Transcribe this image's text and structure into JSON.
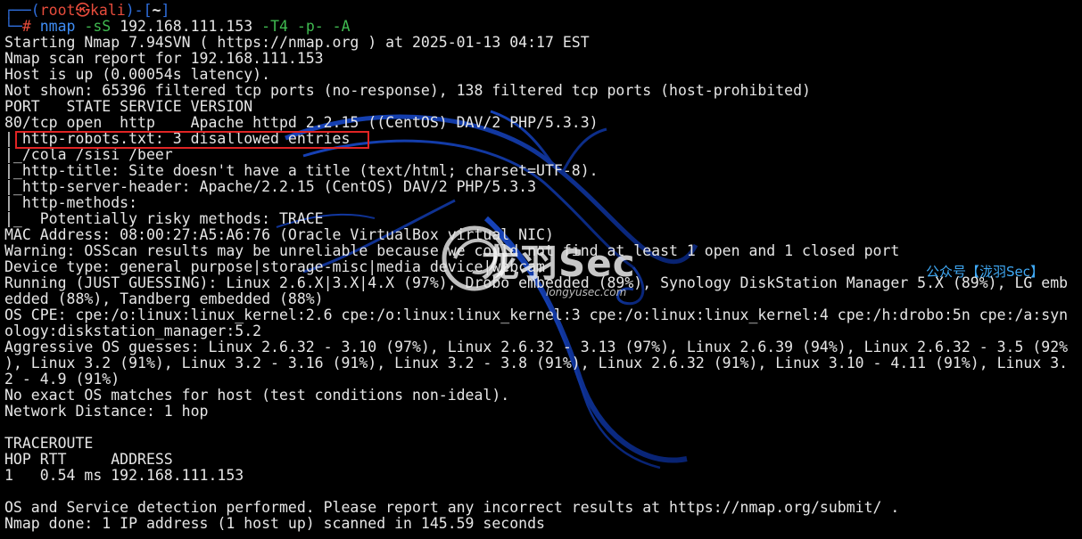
{
  "prompt": {
    "frame_top": "┌──(",
    "user": "root㉿kali",
    "frame_mid": ")-[",
    "dir": "~",
    "frame_end": "]",
    "frame_bottom": "└─",
    "hash": "# ",
    "command": "nmap",
    "flag1": "-sS",
    "target": "192.168.111.153",
    "flag2": "-T4",
    "flag3": "-p-",
    "flag4": "-A"
  },
  "output_lines": [
    "Starting Nmap 7.94SVN ( https://nmap.org ) at 2025-01-13 04:17 EST",
    "Nmap scan report for 192.168.111.153",
    "Host is up (0.00054s latency).",
    "Not shown: 65396 filtered tcp ports (no-response), 138 filtered tcp ports (host-prohibited)",
    "PORT   STATE SERVICE VERSION",
    "80/tcp open  http    Apache httpd 2.2.15 ((CentOS) DAV/2 PHP/5.3.3)",
    "| http-robots.txt: 3 disallowed entries",
    "|_/cola /sisi /beer",
    "|_http-title: Site doesn't have a title (text/html; charset=UTF-8).",
    "|_http-server-header: Apache/2.2.15 (CentOS) DAV/2 PHP/5.3.3",
    "| http-methods:",
    "|_  Potentially risky methods: TRACE",
    "MAC Address: 08:00:27:A5:A6:76 (Oracle VirtualBox virtual NIC)",
    "Warning: OSScan results may be unreliable because we could not find at least 1 open and 1 closed port",
    "Device type: general purpose|storage-misc|media device|webcam",
    "Running (JUST GUESSING): Linux 2.6.X|3.X|4.X (97%), Drobo embedded (89%), Synology DiskStation Manager 5.X (89%), LG emb",
    "edded (88%), Tandberg embedded (88%)",
    "OS CPE: cpe:/o:linux:linux_kernel:2.6 cpe:/o:linux:linux_kernel:3 cpe:/o:linux:linux_kernel:4 cpe:/h:drobo:5n cpe:/a:syn",
    "ology:diskstation_manager:5.2",
    "Aggressive OS guesses: Linux 2.6.32 - 3.10 (97%), Linux 2.6.32 - 3.13 (97%), Linux 2.6.39 (94%), Linux 2.6.32 - 3.5 (92%",
    "), Linux 3.2 (91%), Linux 3.2 - 3.16 (91%), Linux 3.2 - 3.8 (91%), Linux 2.6.32 (91%), Linux 3.10 - 4.11 (91%), Linux 3.",
    "2 - 4.9 (91%)",
    "No exact OS matches for host (test conditions non-ideal).",
    "Network Distance: 1 hop",
    "",
    "TRACEROUTE",
    "HOP RTT     ADDRESS",
    "1   0.54 ms 192.168.111.153",
    "",
    "OS and Service detection performed. Please report any incorrect results at https://nmap.org/submit/ .",
    "Nmap done: 1 IP address (1 host up) scanned in 145.59 seconds"
  ],
  "watermark": {
    "logo_text": "龙羽Sec",
    "url": "longyusec.com",
    "wechat_tag": "公众号【泷羽Sec】"
  },
  "colors": {
    "background": "#000000",
    "text": "#e6e6e6",
    "prompt_blue": "#2f6fde",
    "prompt_red": "#e74c3c",
    "flag_green": "#3fb950",
    "highlight_red": "#e02424",
    "wechat_blue": "#3fa9f5"
  },
  "icons": {
    "watermark_dragon": "kali-dragon-icon",
    "watermark_logo": "longyu-logo-icon"
  }
}
